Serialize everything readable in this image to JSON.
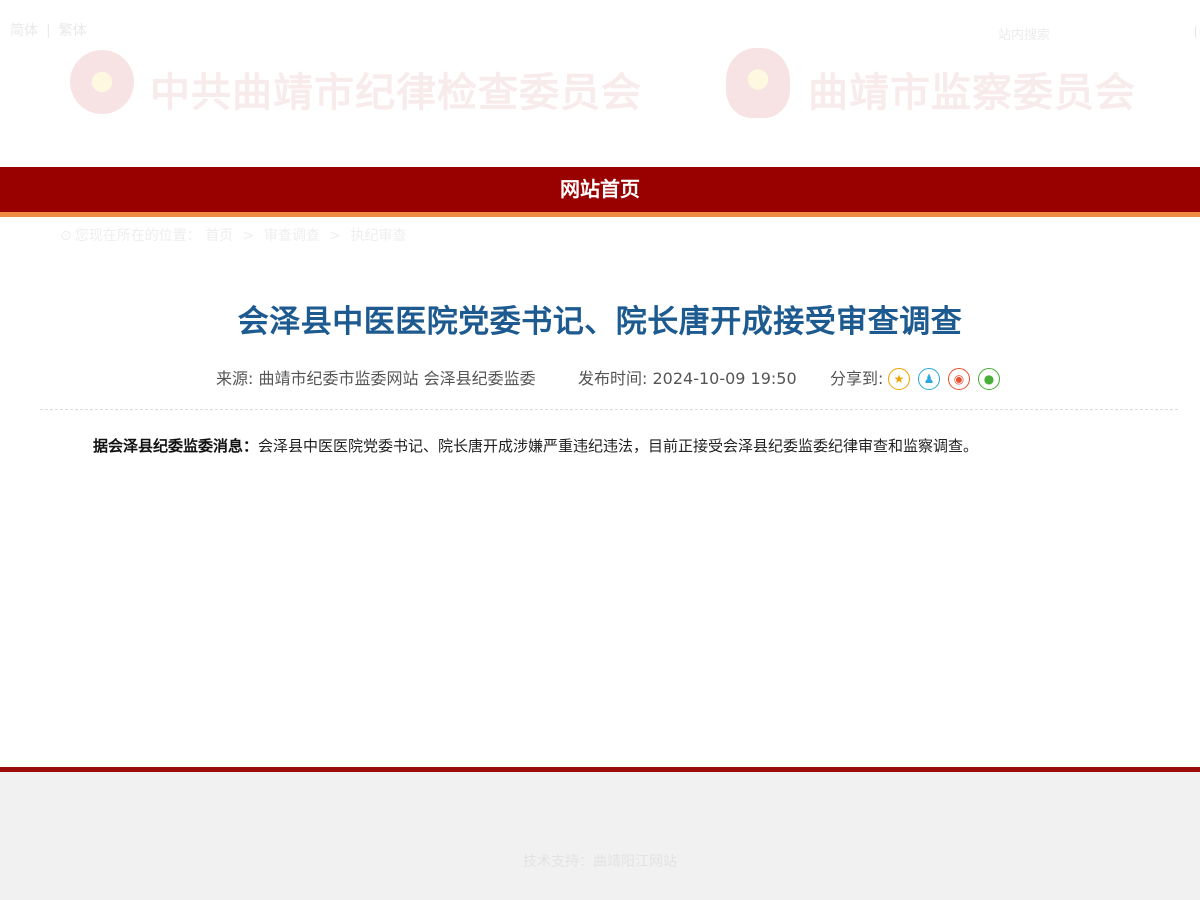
{
  "header": {
    "lang": {
      "simplified": "简体",
      "separator": "|",
      "traditional": "繁体"
    },
    "search_ghost": "站内搜索",
    "org_cpc": "中共曲靖市纪律检查委员会",
    "org_supervision": "曲靖市监察委员会"
  },
  "nav": {
    "home": "网站首页"
  },
  "breadcrumb": {
    "prefix": "您现在所在的位置：",
    "items": [
      "首页",
      "审查调查",
      "执纪审查"
    ],
    "arrow": ">"
  },
  "article": {
    "title": "会泽县中医医院党委书记、院长唐开成接受审查调查",
    "source": "来源: 曲靖市纪委市监委网站 会泽县纪委监委",
    "time": "发布时间: 2024-10-09 19:50",
    "share_label": "分享到:",
    "share_icons": [
      "favorite-icon",
      "qq-icon",
      "weibo-icon",
      "wechat-icon"
    ],
    "lead": "据会泽县纪委监委消息：",
    "body": "会泽县中医医院党委书记、院长唐开成涉嫌严重违纪违法，目前正接受会泽县纪委监委纪律审查和监察调查。"
  },
  "footer": {
    "support": "技术支持：曲靖阳江网站"
  },
  "colors": {
    "nav_red": "#990000",
    "nav_underline": "#f08a43",
    "title_blue": "#1d5a8f",
    "footer_line": "#9c0c0c",
    "footer_bg": "#f1f1f1"
  }
}
